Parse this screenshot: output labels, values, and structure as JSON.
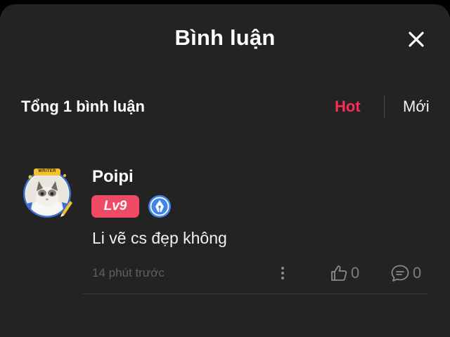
{
  "header": {
    "title": "Bình luận",
    "close_icon": "close-icon"
  },
  "summary": {
    "total_label": "Tổng 1 bình luận",
    "sort_hot": "Hot",
    "sort_new": "Mới",
    "active_sort": "Hot"
  },
  "comments": [
    {
      "avatar": {
        "icon": "cat-avatar-writer-frame",
        "frame_text": "WRITER"
      },
      "username": "Poipi",
      "level": "Lv9",
      "badge_icon": "pen-nib-badge-icon",
      "text": "Li vẽ cs đẹp không",
      "timestamp": "14 phút trước",
      "more_icon": "more-vertical-icon",
      "likes": "0",
      "replies": "0"
    }
  ],
  "colors": {
    "background": "#232324",
    "accent": "#fe2c55",
    "level_badge": "#f04965",
    "writer_badge": "#3f86e8",
    "muted": "#7e7e82"
  }
}
